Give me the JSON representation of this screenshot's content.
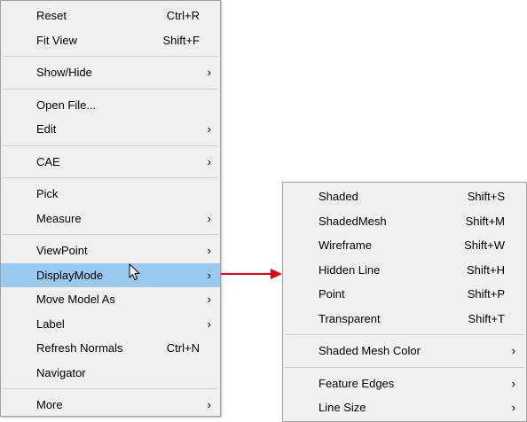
{
  "main_menu": {
    "reset": {
      "label": "Reset",
      "shortcut": "Ctrl+R"
    },
    "fit_view": {
      "label": "Fit View",
      "shortcut": "Shift+F"
    },
    "show_hide": {
      "label": "Show/Hide",
      "arrow": "›"
    },
    "open_file": {
      "label": "Open File..."
    },
    "edit": {
      "label": "Edit",
      "arrow": "›"
    },
    "cae": {
      "label": "CAE",
      "arrow": "›"
    },
    "pick": {
      "label": "Pick"
    },
    "measure": {
      "label": "Measure",
      "arrow": "›"
    },
    "viewpoint": {
      "label": "ViewPoint",
      "arrow": "›"
    },
    "display_mode": {
      "label": "DisplayMode",
      "arrow": "›"
    },
    "move_model_as": {
      "label": "Move Model As",
      "arrow": "›"
    },
    "label": {
      "label": "Label",
      "arrow": "›"
    },
    "refresh_normals": {
      "label": "Refresh Normals",
      "shortcut": "Ctrl+N"
    },
    "navigator": {
      "label": "Navigator"
    },
    "more": {
      "label": "More",
      "arrow": "›"
    }
  },
  "display_submenu": {
    "shaded": {
      "label": "Shaded",
      "shortcut": "Shift+S"
    },
    "shaded_mesh": {
      "label": "ShadedMesh",
      "shortcut": "Shift+M"
    },
    "wireframe": {
      "label": "Wireframe",
      "shortcut": "Shift+W"
    },
    "hidden_line": {
      "label": "Hidden Line",
      "shortcut": "Shift+H"
    },
    "point": {
      "label": "Point",
      "shortcut": "Shift+P"
    },
    "transparent": {
      "label": "Transparent",
      "shortcut": "Shift+T"
    },
    "shaded_mesh_color": {
      "label": "Shaded Mesh Color",
      "arrow": "›"
    },
    "feature_edges": {
      "label": "Feature Edges",
      "arrow": "›"
    },
    "line_size": {
      "label": "Line Size",
      "arrow": "›"
    }
  },
  "colors": {
    "highlight": "#99c9ef",
    "pointer_arrow": "#e8000b",
    "menu_bg": "#f0f0f0"
  },
  "icons": {
    "cursor": "mouse-cursor-icon",
    "pointer": "red-arrow-icon"
  }
}
